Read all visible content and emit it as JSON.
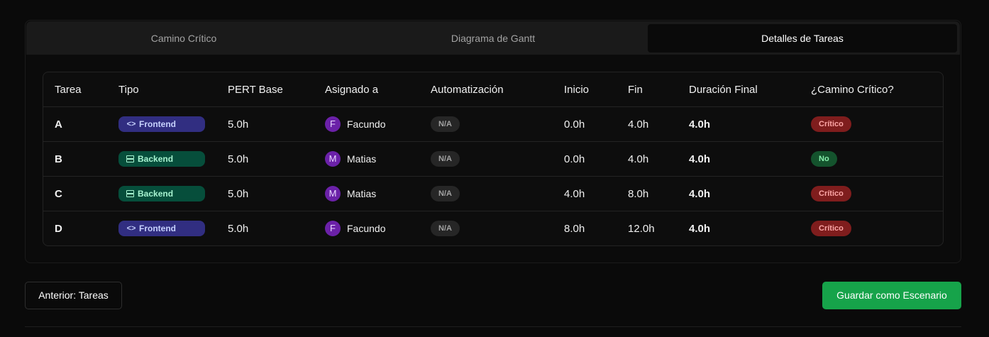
{
  "tabs": {
    "critical_path": "Camino Crítico",
    "gantt": "Diagrama de Gantt",
    "details": "Detalles de Tareas",
    "active": "details"
  },
  "table": {
    "headers": {
      "task": "Tarea",
      "type": "Tipo",
      "pert": "PERT Base",
      "assignee": "Asignado a",
      "automation": "Automatización",
      "start": "Inicio",
      "end": "Fin",
      "duration": "Duración Final",
      "critical": "¿Camino Crítico?"
    },
    "rows": [
      {
        "task": "A",
        "type": "Frontend",
        "type_icon": "code-icon",
        "pert": "5.0h",
        "avatar": "F",
        "assignee": "Facundo",
        "automation": "N/A",
        "start": "0.0h",
        "end": "4.0h",
        "duration": "4.0h",
        "critical": "Crítico",
        "critical_status": "yes"
      },
      {
        "task": "B",
        "type": "Backend",
        "type_icon": "server-icon",
        "pert": "5.0h",
        "avatar": "M",
        "assignee": "Matias",
        "automation": "N/A",
        "start": "0.0h",
        "end": "4.0h",
        "duration": "4.0h",
        "critical": "No",
        "critical_status": "no"
      },
      {
        "task": "C",
        "type": "Backend",
        "type_icon": "server-icon",
        "pert": "5.0h",
        "avatar": "M",
        "assignee": "Matias",
        "automation": "N/A",
        "start": "4.0h",
        "end": "8.0h",
        "duration": "4.0h",
        "critical": "Crítico",
        "critical_status": "yes"
      },
      {
        "task": "D",
        "type": "Frontend",
        "type_icon": "code-icon",
        "pert": "5.0h",
        "avatar": "F",
        "assignee": "Facundo",
        "automation": "N/A",
        "start": "8.0h",
        "end": "12.0h",
        "duration": "4.0h",
        "critical": "Crítico",
        "critical_status": "yes"
      }
    ]
  },
  "buttons": {
    "previous": "Anterior: Tareas",
    "save": "Guardar como Escenario"
  },
  "colors": {
    "accent_green": "#16a34a",
    "frontend_badge": "#312e81",
    "backend_badge": "#064e3b",
    "critical_badge": "#7f1d1d",
    "non_critical_badge": "#14532d",
    "avatar": "#6b21a8"
  }
}
